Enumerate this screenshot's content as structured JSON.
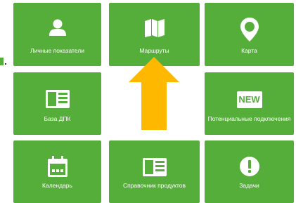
{
  "tiles": [
    {
      "label": "Личные показатели",
      "icon": "person-icon"
    },
    {
      "label": "Маршруты",
      "icon": "map-icon"
    },
    {
      "label": "Карта",
      "icon": "location-pin-icon"
    },
    {
      "label": "База ДПК",
      "icon": "database-card-icon"
    },
    {
      "label": "Потенциальные подключения",
      "icon": "new-badge-icon",
      "badge_text": "NEW"
    },
    {
      "label": "Календарь",
      "icon": "calendar-icon"
    },
    {
      "label": "Справочник продуктов",
      "icon": "product-catalog-icon"
    },
    {
      "label": "Задачи",
      "icon": "exclamation-icon"
    }
  ],
  "colors": {
    "tile_bg": "#56ae3a",
    "tile_text": "#ffffff",
    "arrow": "#ffb800"
  },
  "overlay": {
    "arrow_icon": "up-arrow-icon"
  }
}
